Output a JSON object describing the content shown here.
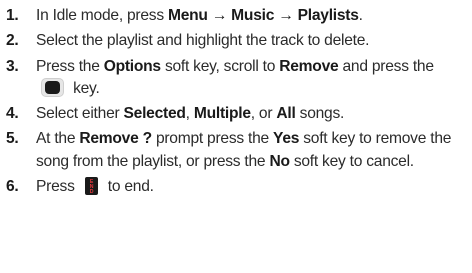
{
  "steps": [
    {
      "num": "1.",
      "parts": [
        {
          "t": "In Idle mode, press "
        },
        {
          "b": "Menu → Music → Playlists"
        },
        {
          "t": "."
        }
      ]
    },
    {
      "num": "2.",
      "parts": [
        {
          "t": "Select the playlist and highlight the track to delete."
        }
      ]
    },
    {
      "num": "3.",
      "parts": [
        {
          "t": "Press the "
        },
        {
          "b": "Options"
        },
        {
          "t": " soft key, scroll to "
        },
        {
          "b": "Remove"
        },
        {
          "t": " and press the "
        },
        {
          "icon": "center-select-key-icon"
        },
        {
          "t": " key."
        }
      ]
    },
    {
      "num": "4.",
      "parts": [
        {
          "t": "Select either "
        },
        {
          "b": "Selected"
        },
        {
          "t": ", "
        },
        {
          "b": "Multiple"
        },
        {
          "t": ", or "
        },
        {
          "b": "All"
        },
        {
          "t": " songs."
        }
      ]
    },
    {
      "num": "5.",
      "parts": [
        {
          "t": "At the "
        },
        {
          "b": "Remove ?"
        },
        {
          "t": " prompt press the "
        },
        {
          "b": "Yes"
        },
        {
          "t": " soft key to remove the song from the playlist, or press the "
        },
        {
          "b": "No"
        },
        {
          "t": " soft key to cancel."
        }
      ]
    },
    {
      "num": "6.",
      "parts": [
        {
          "t": "Press "
        },
        {
          "icon": "end-key-icon"
        },
        {
          "t": " to end."
        }
      ]
    }
  ],
  "icons": {
    "end_key_letters": "END",
    "end_key_color": "#e8393d",
    "key_body_color": "#1a1a1a"
  }
}
